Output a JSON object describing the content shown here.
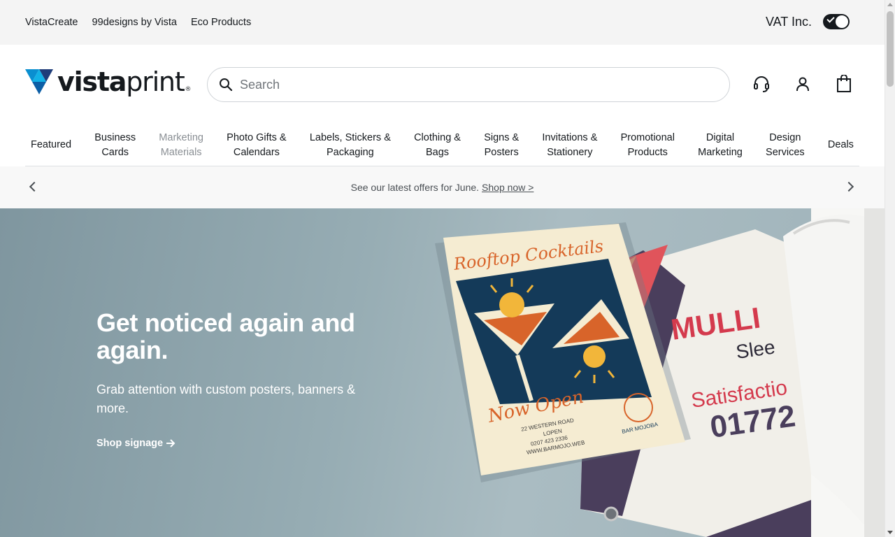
{
  "utility": {
    "links": [
      "VistaCreate",
      "99designs by Vista",
      "Eco Products"
    ],
    "vat_label": "VAT Inc."
  },
  "header": {
    "logo_brand": "vista",
    "logo_brand2": "print",
    "logo_mark": "®",
    "search_placeholder": "Search",
    "icons": [
      "headset-icon",
      "account-icon",
      "cart-icon"
    ]
  },
  "nav": {
    "items": [
      {
        "line1": "Featured",
        "line2": ""
      },
      {
        "line1": "Business",
        "line2": "Cards"
      },
      {
        "line1": "Marketing",
        "line2": "Materials"
      },
      {
        "line1": "Photo Gifts &",
        "line2": "Calendars"
      },
      {
        "line1": "Labels, Stickers &",
        "line2": "Packaging"
      },
      {
        "line1": "Clothing &",
        "line2": "Bags"
      },
      {
        "line1": "Signs &",
        "line2": "Posters"
      },
      {
        "line1": "Invitations &",
        "line2": "Stationery"
      },
      {
        "line1": "Promotional",
        "line2": "Products"
      },
      {
        "line1": "Digital",
        "line2": "Marketing"
      },
      {
        "line1": "Design",
        "line2": "Services"
      },
      {
        "line1": "Deals",
        "line2": ""
      }
    ]
  },
  "promo": {
    "text": "See our latest offers for June.",
    "link": "Shop now >"
  },
  "hero": {
    "title": "Get noticed again and again.",
    "subtitle": "Grab attention with custom posters, banners & more.",
    "cta": "Shop signage",
    "poster": {
      "headline": "Rooftop Cocktails",
      "footer": "Now Open",
      "address1": "22 WESTERN ROAD",
      "address2": "LOPEN",
      "phone": "0207 423 2336",
      "web": "WWW.BARMOJO.WEB",
      "brand": "BAR MOJOBA"
    },
    "banner": {
      "line1": "MULLI",
      "line2": "Slee",
      "line3": "Satisfactio",
      "line4": "01772"
    }
  },
  "colors": {
    "text": "#15191d",
    "hero_bg": "#97adb4",
    "poster_navy": "#123a5a",
    "poster_orange": "#d8642a",
    "banner_red": "#d43a4d"
  }
}
